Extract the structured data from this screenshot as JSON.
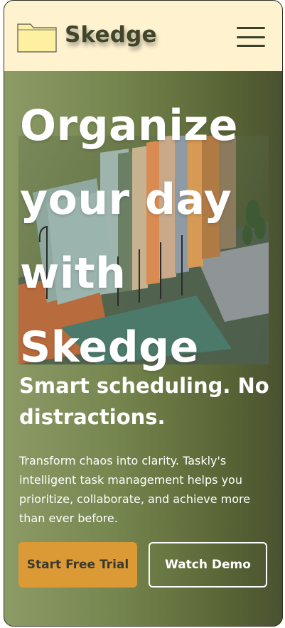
{
  "header": {
    "brand": "Skedge",
    "logo_icon": "folder-icon",
    "menu_icon": "hamburger-menu-icon"
  },
  "hero": {
    "title": "Organize your day with Skedge",
    "subtitle": "Smart scheduling. No distractions.",
    "description": "Transform chaos into clarity. Taskly's intelligent task management helps you prioritize, collaborate, and achieve more than ever before.",
    "image_icon": "file-organizer-image"
  },
  "actions": {
    "primary_label": "Start Free Trial",
    "secondary_label": "Watch Demo"
  },
  "colors": {
    "header_bg": "#fff2cf",
    "accent": "#dc9a37",
    "hero_bg": "#76864f"
  }
}
